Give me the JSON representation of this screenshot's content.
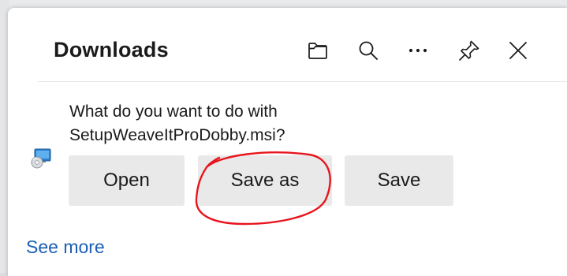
{
  "panel": {
    "title": "Downloads"
  },
  "toolbar": {
    "buttons": [
      {
        "name": "folder-icon",
        "tooltip": "Open downloads folder"
      },
      {
        "name": "search-icon",
        "tooltip": "Search downloads"
      },
      {
        "name": "more-options-icon",
        "tooltip": "More options"
      },
      {
        "name": "pin-icon",
        "tooltip": "Pin downloads"
      },
      {
        "name": "close-icon",
        "tooltip": "Close"
      }
    ]
  },
  "download": {
    "prompt_line1": "What do you want to do with",
    "prompt_line2": "SetupWeaveItProDobby.msi?",
    "file_icon": "msi-installer-icon",
    "actions": {
      "open": "Open",
      "save_as": "Save as",
      "save": "Save"
    }
  },
  "footer": {
    "see_more": "See more"
  },
  "colors": {
    "link": "#1a5fb4",
    "button_bg": "#e9e9e9",
    "annotation": "#e8141c"
  }
}
